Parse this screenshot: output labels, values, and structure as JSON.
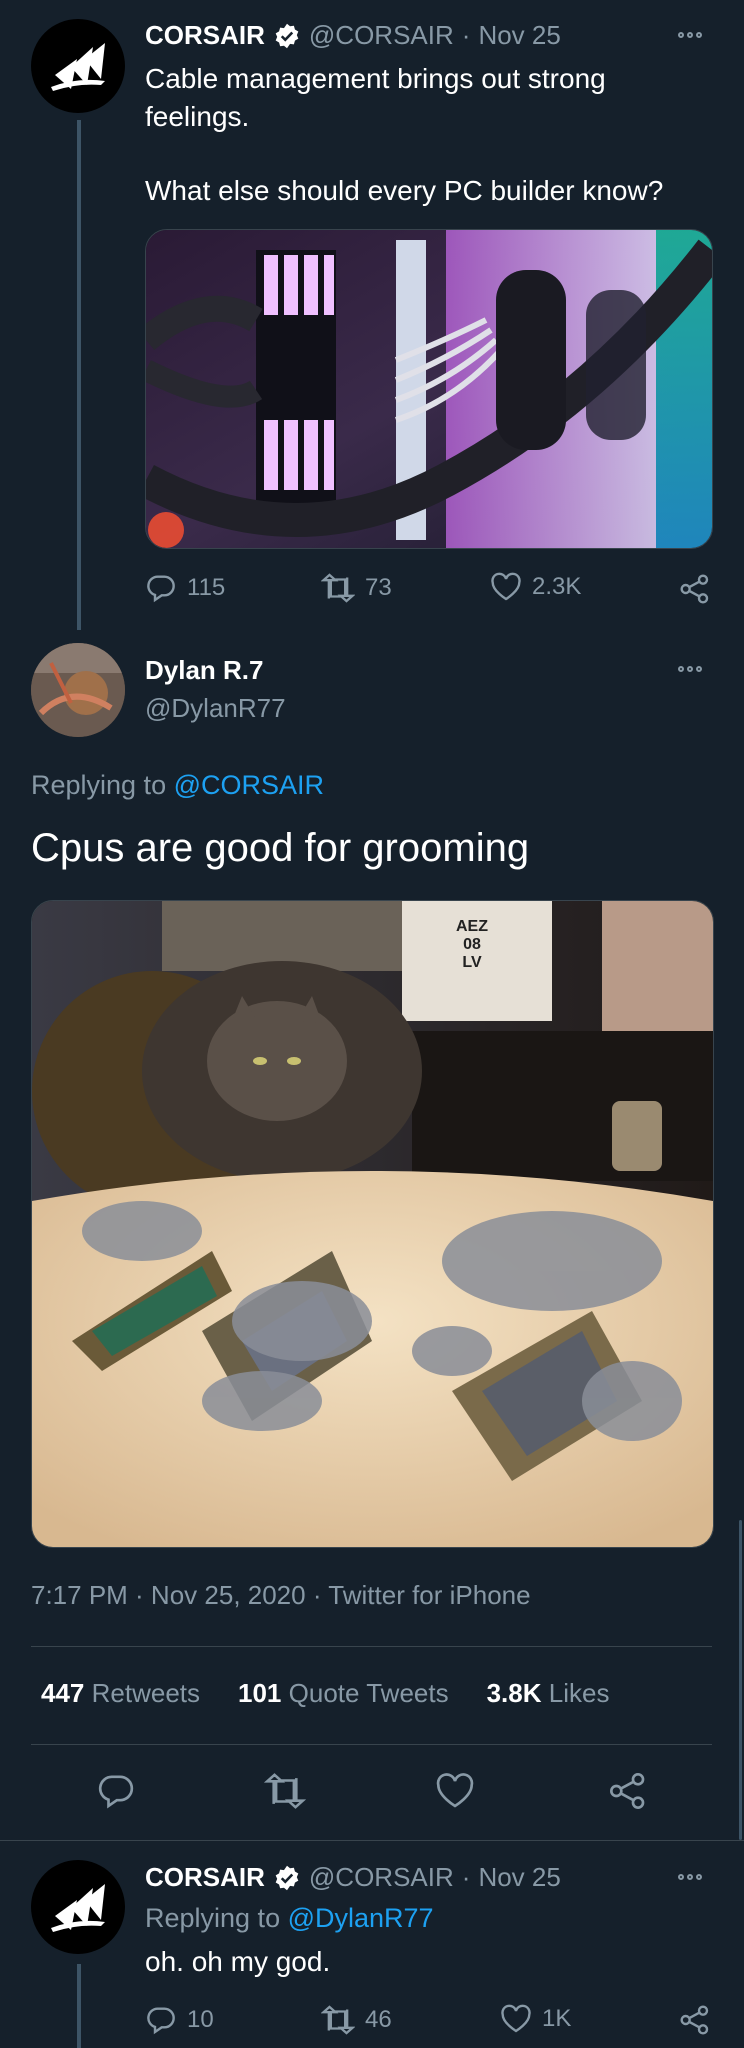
{
  "tweet1": {
    "display_name": "CORSAIR",
    "handle": "@CORSAIR",
    "sep": "·",
    "date": "Nov 25",
    "text_line1": "Cable management brings out strong",
    "text_line2": "feelings.",
    "text_line3": "What else should every PC builder know?",
    "replies": "115",
    "retweets": "73",
    "likes": "2.3K"
  },
  "main_tweet": {
    "display_name": "Dylan R.7",
    "handle": "@DylanR77",
    "replying_prefix": "Replying to",
    "replying_to": "@CORSAIR",
    "text": "Cpus are good for grooming",
    "image_box_text": "AEZ\n08\nLV",
    "timestamp": "7:17 PM · Nov 25, 2020",
    "source_sep": "·",
    "source": "Twitter for iPhone",
    "stats": {
      "retweets_count": "447",
      "retweets_label": "Retweets",
      "quotes_count": "101",
      "quotes_label": "Quote Tweets",
      "likes_count": "3.8K",
      "likes_label": "Likes"
    }
  },
  "tweet3": {
    "display_name": "CORSAIR",
    "handle": "@CORSAIR",
    "sep": "·",
    "date": "Nov 25",
    "replying_prefix": "Replying to",
    "replying_to": "@DylanR77",
    "text": "oh. oh my god.",
    "replies": "10",
    "retweets": "46",
    "likes": "1K"
  },
  "colors": {
    "background": "#15202b",
    "muted": "#8899a6",
    "link": "#1da1f2",
    "divider": "#38444d"
  }
}
